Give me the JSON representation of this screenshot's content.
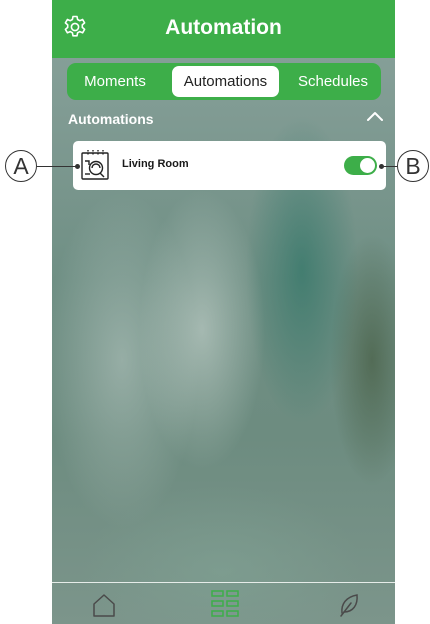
{
  "header": {
    "title": "Automation",
    "settings_icon": "gear-icon",
    "color": "#3dae49"
  },
  "tabs": [
    {
      "label": "Moments",
      "selected": false
    },
    {
      "label": "Automations",
      "selected": true
    },
    {
      "label": "Schedules",
      "selected": false
    }
  ],
  "section": {
    "title": "Automations",
    "collapse_icon": "chevron-up-icon"
  },
  "automations": [
    {
      "label": "Living Room",
      "icon": "automation-icon",
      "enabled": true
    }
  ],
  "bottom_nav": [
    {
      "icon": "home-icon",
      "active": false
    },
    {
      "icon": "grid-icon",
      "active": true
    },
    {
      "icon": "leaf-icon",
      "active": false
    }
  ],
  "callouts": {
    "a": "A",
    "b": "B"
  }
}
